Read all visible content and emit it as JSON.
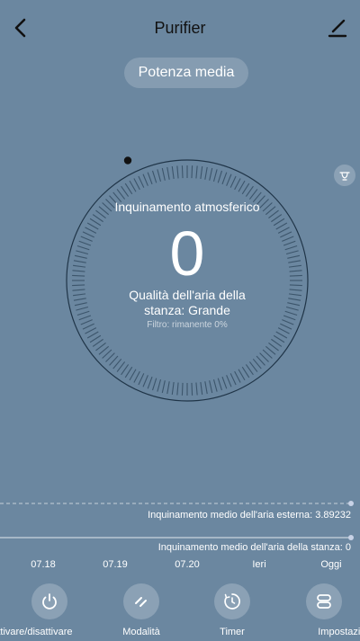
{
  "header": {
    "title": "Purifier",
    "back_icon": "back-chevron-icon",
    "edit_icon": "edit-pen-icon"
  },
  "mode": {
    "label": "Potenza media"
  },
  "side_icon": "fan-icon",
  "dial": {
    "label": "Inquinamento atmosferico",
    "value": "0",
    "quality": "Qualità dell'aria della stanza: Grande",
    "filter": "Filtro: rimanente 0%"
  },
  "chart_data": {
    "type": "line",
    "categories": [
      "07.18",
      "07.19",
      "07.20",
      "Ieri",
      "Oggi"
    ],
    "series": [
      {
        "name": "Inquinamento medio dell'aria esterna: 3.89232",
        "values": [
          null,
          null,
          null,
          null,
          3.89232
        ]
      },
      {
        "name": "Inquinamento medio dell'aria della stanza: 0",
        "values": [
          null,
          null,
          null,
          null,
          0
        ]
      }
    ]
  },
  "bottom": {
    "power_label": "Attivare/disattivare",
    "mode_label": "Modalità",
    "timer_label": "Timer",
    "settings_label": "Impostazioni"
  },
  "colors": {
    "background": "#6b87a0",
    "text": "#ffffff",
    "title": "#111111"
  }
}
